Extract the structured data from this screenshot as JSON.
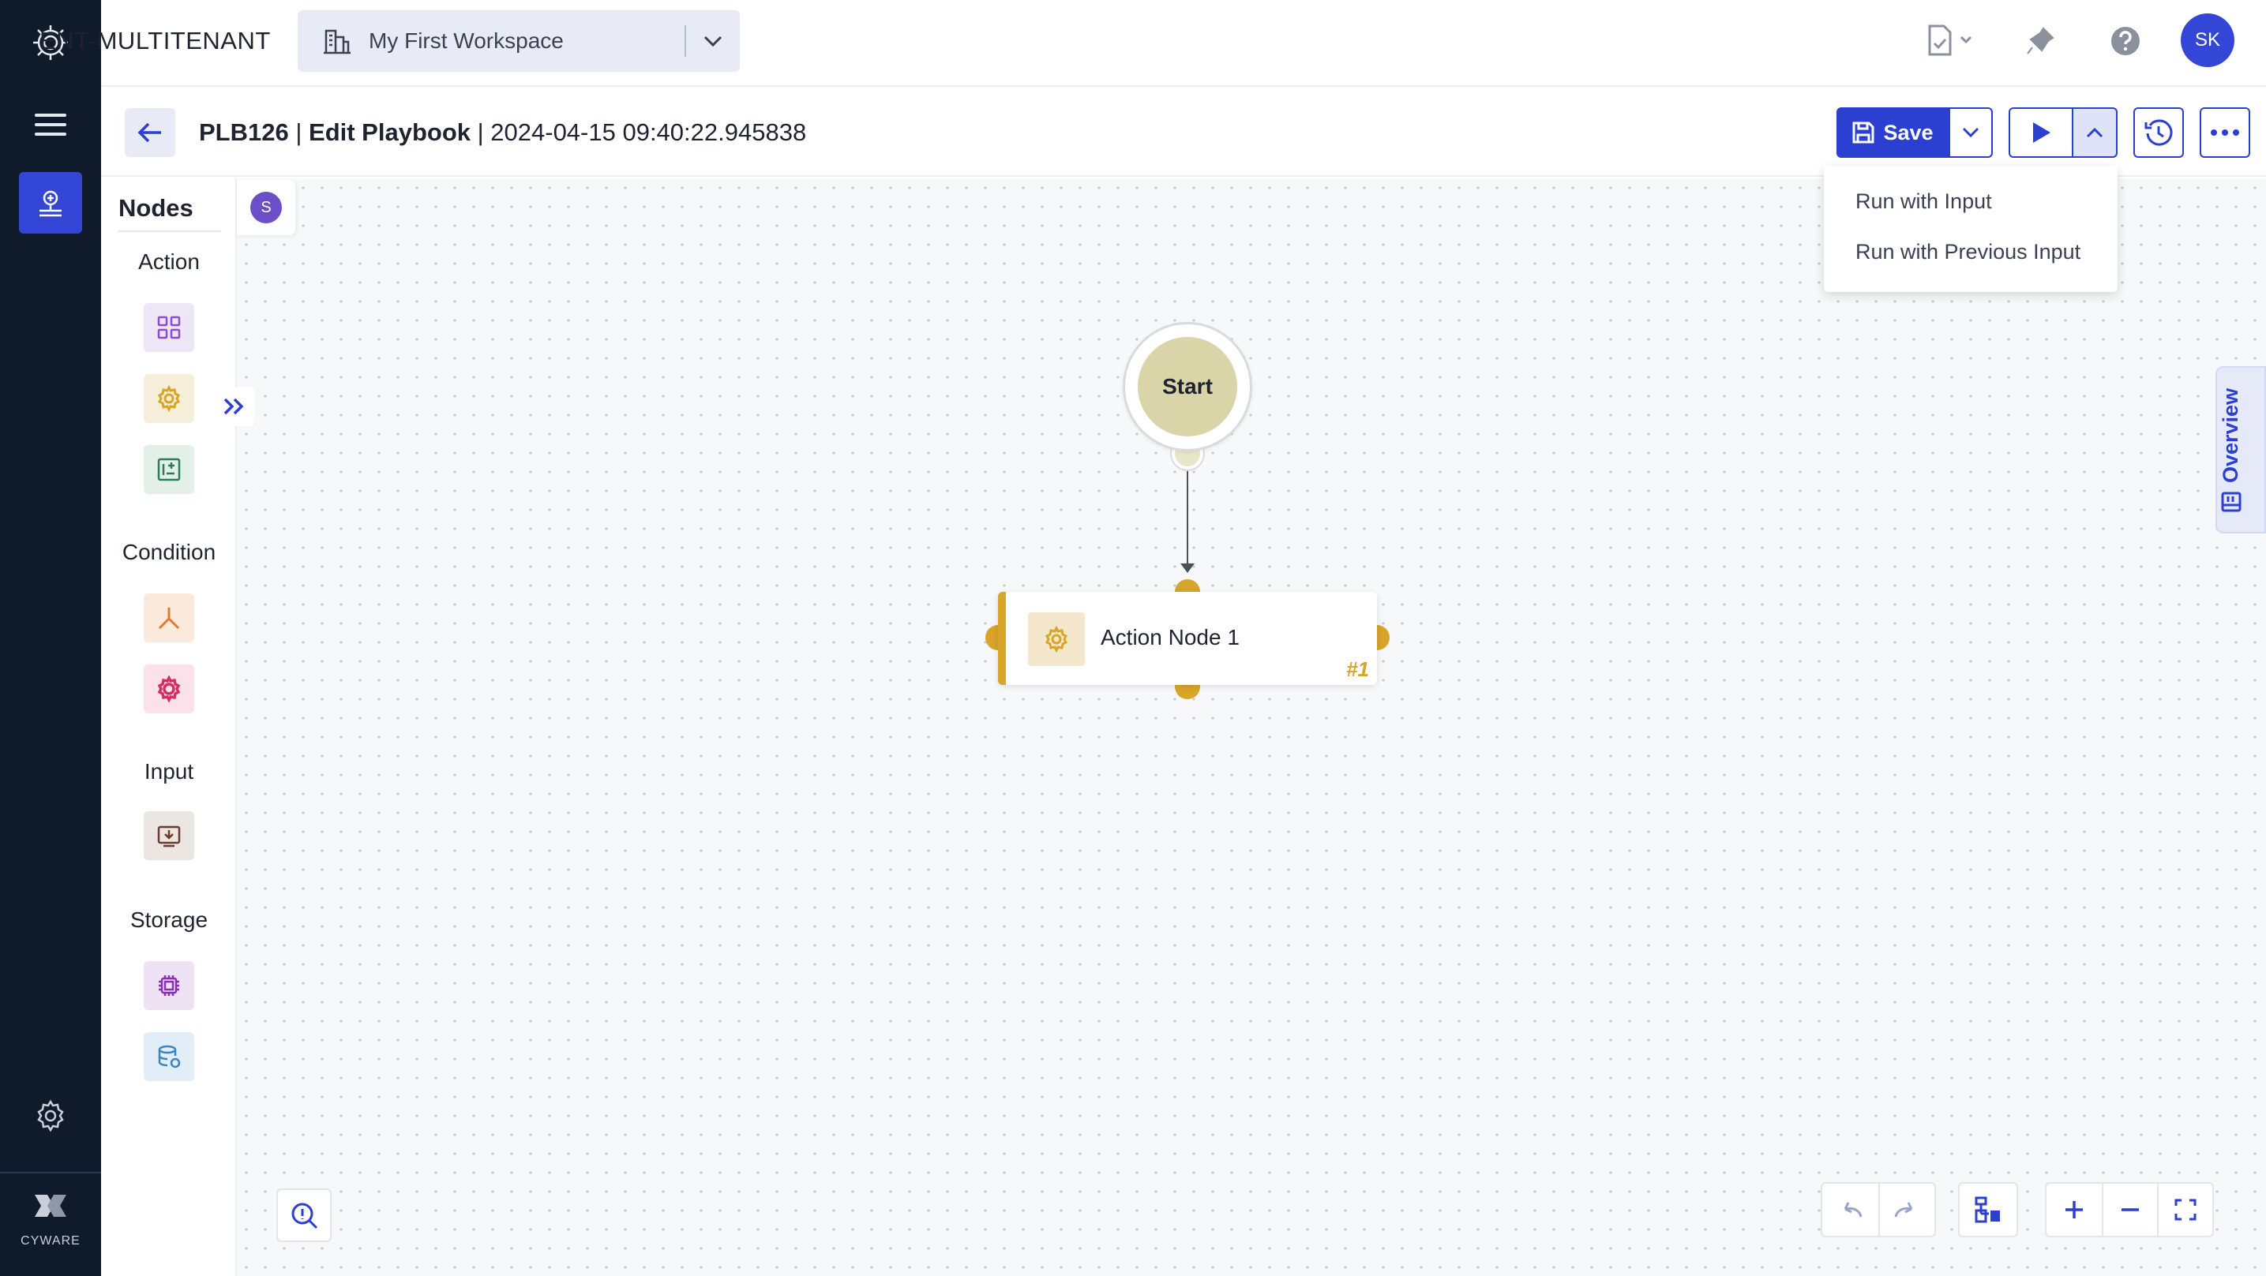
{
  "rail": {
    "brand_text": "CYWARE"
  },
  "topbar": {
    "tenant": "ENT-MULTITENANT",
    "workspace": "My First Workspace",
    "user_initials": "SK"
  },
  "header": {
    "playbook_id": "PLB126",
    "separator1": " | ",
    "mode": "Edit Playbook",
    "separator2": " | ",
    "timestamp": "2024-04-15 09:40:22.945838",
    "save_label": "Save"
  },
  "run_menu": {
    "items": [
      {
        "label": "Run with Input"
      },
      {
        "label": "Run with Previous Input"
      }
    ]
  },
  "nodes_panel": {
    "title": "Nodes",
    "badge": "S",
    "sections": {
      "action": "Action",
      "condition": "Condition",
      "input": "Input",
      "storage": "Storage"
    }
  },
  "flow": {
    "start_label": "Start",
    "action_node": {
      "label": "Action Node 1",
      "number": "#1"
    }
  },
  "overview_tab": {
    "label": "Overview"
  },
  "colors": {
    "primary": "#2b3fd0",
    "rail_bg": "#0f1a2b",
    "action_accent": "#d9a42a",
    "start_fill": "#d9d5a9"
  },
  "icons": [
    "cyware-logo-icon",
    "hamburger-icon",
    "playbook-icon",
    "settings-gear-icon",
    "building-icon",
    "chevron-down-icon",
    "document-check-icon",
    "bell-icon",
    "help-icon",
    "arrow-left-icon",
    "save-disk-icon",
    "play-icon",
    "chevron-up-icon",
    "history-icon",
    "more-dots-icon",
    "grid-icon",
    "gear-icon",
    "code-bracket-icon",
    "branch-icon",
    "pink-gear-icon",
    "input-box-icon",
    "chip-icon",
    "database-icon",
    "double-chevron-right-icon",
    "zoom-search-icon",
    "undo-icon",
    "redo-icon",
    "layout-icon",
    "plus-icon",
    "minus-icon",
    "fit-screen-icon"
  ]
}
